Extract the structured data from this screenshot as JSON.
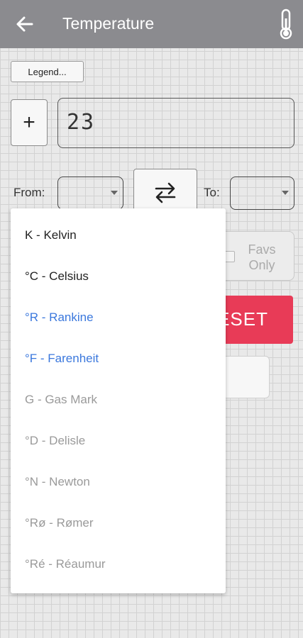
{
  "appbar": {
    "title": "Temperature",
    "back_icon": "arrow-left-icon",
    "thermometer_icon": "thermometer-icon"
  },
  "legend_button": "Legend...",
  "sign_button": "+",
  "value_input": {
    "value": "23"
  },
  "from_label": "From:",
  "to_label": "To:",
  "favs_only": "Favs Only",
  "reset_button": "ESET",
  "colors": {
    "appbar": "#8b8b8f",
    "reset": "#e83b57",
    "highlight": "#3b78dd"
  },
  "units": [
    {
      "label": "K - Kelvin",
      "style": "dark"
    },
    {
      "label": "°C - Celsius",
      "style": "dark"
    },
    {
      "label": "°R - Rankine",
      "style": "blue"
    },
    {
      "label": "°F - Farenheit",
      "style": "blue"
    },
    {
      "label": "G - Gas Mark",
      "style": "grey"
    },
    {
      "label": "°D - Delisle",
      "style": "grey"
    },
    {
      "label": "°N - Newton",
      "style": "grey"
    },
    {
      "label": "°Rø - Rømer",
      "style": "grey"
    },
    {
      "label": "°Ré - Réaumur",
      "style": "grey"
    }
  ]
}
